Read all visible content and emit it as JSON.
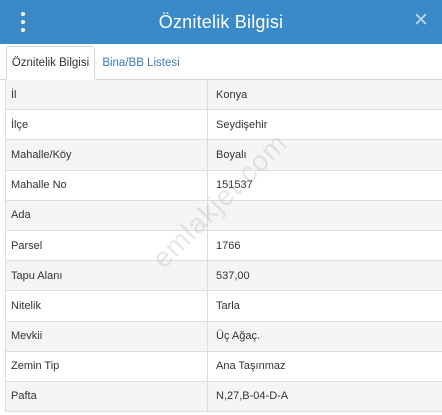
{
  "header": {
    "title": "Öznitelik Bilgisi"
  },
  "tabs": [
    {
      "label": "Öznitelik Bilgisi"
    },
    {
      "label": "Bina/BB Listesi"
    }
  ],
  "rows": [
    {
      "label": "İl",
      "value": "Konya"
    },
    {
      "label": "İlçe",
      "value": "Seydişehir"
    },
    {
      "label": "Mahalle/Köy",
      "value": "Boyalı"
    },
    {
      "label": "Mahalle No",
      "value": "151537"
    },
    {
      "label": "Ada",
      "value": ""
    },
    {
      "label": "Parsel",
      "value": "1766"
    },
    {
      "label": "Tapu Alanı",
      "value": "537,00"
    },
    {
      "label": "Nitelik",
      "value": "Tarla"
    },
    {
      "label": "Mevkii",
      "value": "Üç Ağaç."
    },
    {
      "label": "Zemin Tip",
      "value": "Ana Taşınmaz"
    },
    {
      "label": "Pafta",
      "value": "N,27,B-04-D-A"
    }
  ],
  "watermark": "emlakjet.com",
  "colors": {
    "header": "#3a8ac9",
    "tab_link": "#3a7ab8"
  },
  "icons": {
    "menu": "kebab-menu-icon",
    "close": "close-icon"
  }
}
